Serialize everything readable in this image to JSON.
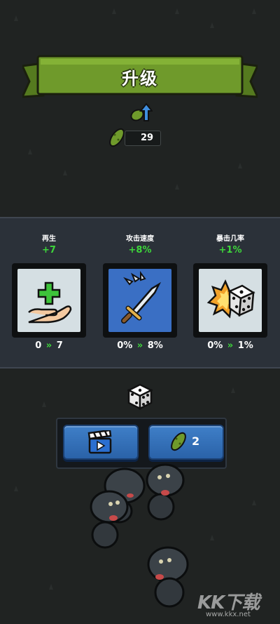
{
  "banner": {
    "title": "升级"
  },
  "currency": {
    "pickle_count": "29",
    "icon": "pickle-icon"
  },
  "level_up_icon": "level-up-arrow-icon",
  "upgrades": [
    {
      "name": "再生",
      "bonus": "+7",
      "from": "0",
      "arrow": "»",
      "to": "7",
      "icon": "heal-hand-icon",
      "bg": "#d5dfe3"
    },
    {
      "name": "攻击速度",
      "bonus": "+8%",
      "from": "0%",
      "arrow": "»",
      "to": "8%",
      "icon": "sword-speed-icon",
      "bg": "#3a6fc4"
    },
    {
      "name": "暴击几率",
      "bonus": "+1%",
      "from": "0%",
      "arrow": "»",
      "to": "1%",
      "icon": "crit-dice-icon",
      "bg": "#d5dfe3"
    }
  ],
  "reroll": {
    "icon": "dice-icon",
    "watch_ad_button_icon": "clapperboard-play-icon",
    "pickle_button_icon": "pickle-icon",
    "pickle_cost": "2"
  },
  "watermark": {
    "main": "KK下载",
    "url": "www.kkx.net"
  },
  "colors": {
    "accent_green": "#3dd63a",
    "banner_green": "#6f9a2b",
    "button_blue": "#3f7fc8"
  }
}
